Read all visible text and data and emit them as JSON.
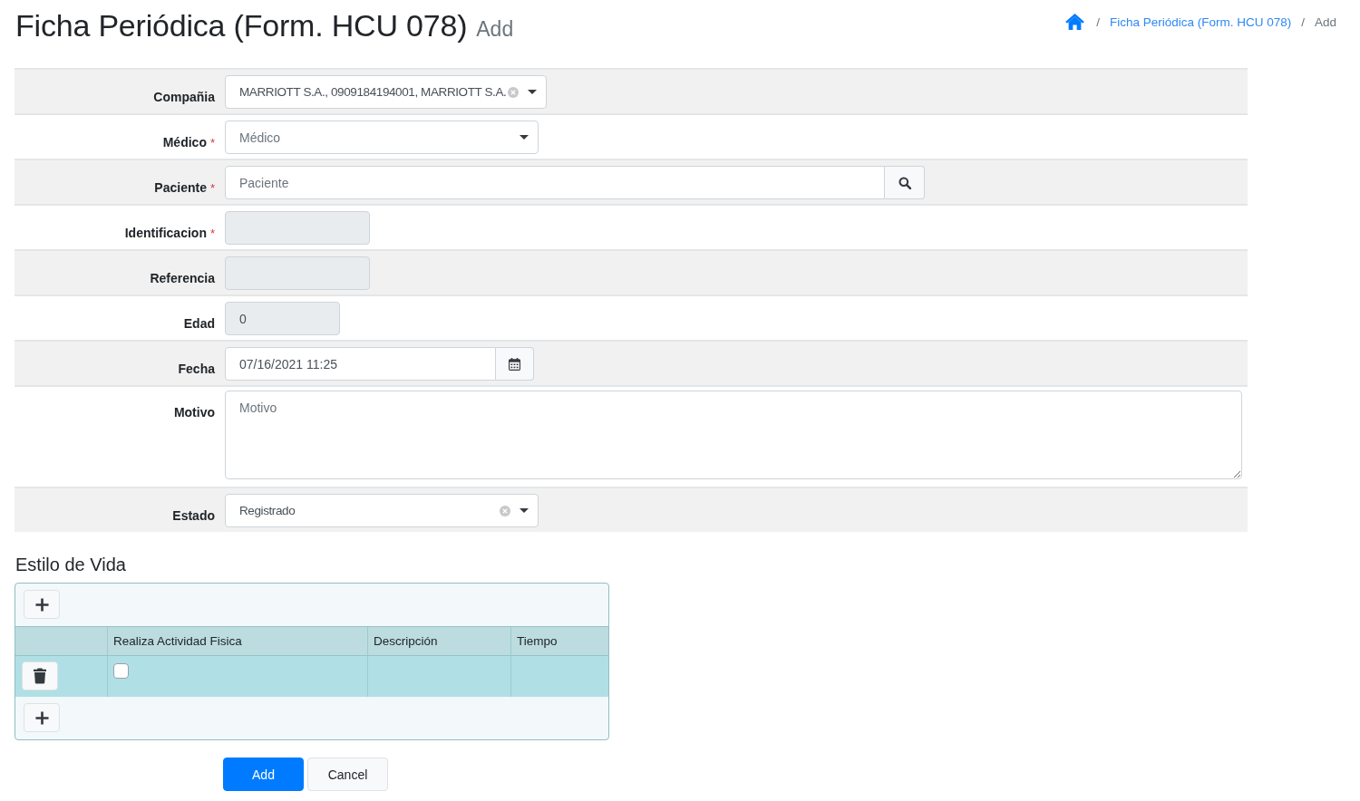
{
  "page_header": {
    "title": "Ficha Periódica (Form. HCU 078)",
    "subtitle": "Add"
  },
  "breadcrumb": [
    {
      "kind": "home"
    },
    {
      "kind": "link",
      "separator": "/",
      "label": "Ficha Periódica (Form. HCU 078)"
    },
    {
      "kind": "current",
      "separator": "/",
      "label": "Add"
    }
  ],
  "form": {
    "fields": [
      {
        "label": "Compañia",
        "kind": "select",
        "value": "MARRIOTT S.A., 0909184194001, MARRIOTT S.A.",
        "clearable": true
      },
      {
        "label": "Médico",
        "required_mark": "*",
        "kind": "select",
        "placeholder": "Médico",
        "clearable": false
      },
      {
        "label": "Paciente",
        "required_mark": "*",
        "kind": "search",
        "placeholder": "Paciente"
      },
      {
        "label": "Identificacion",
        "required_mark": "*",
        "kind": "readonly"
      },
      {
        "label": "Referencia",
        "kind": "readonly"
      },
      {
        "label": "Edad",
        "kind": "number",
        "value": "0"
      },
      {
        "label": "Fecha",
        "kind": "datetime",
        "value": "07/16/2021 11:25"
      },
      {
        "label": "Motivo",
        "kind": "textarea",
        "placeholder": "Motivo"
      },
      {
        "label": "Estado",
        "kind": "select",
        "value": "Registrado",
        "clearable": true
      }
    ]
  },
  "lifestyle": {
    "title": "Estilo de Vida",
    "table": {
      "columns": [
        "Realiza Actividad Fisica",
        "Descripción",
        "Tiempo"
      ],
      "rows": [
        {
          "checked": false
        }
      ]
    }
  },
  "actions": [
    {
      "label": "Add",
      "kind": "primary"
    },
    {
      "label": "Cancel",
      "kind": "secondary"
    }
  ]
}
